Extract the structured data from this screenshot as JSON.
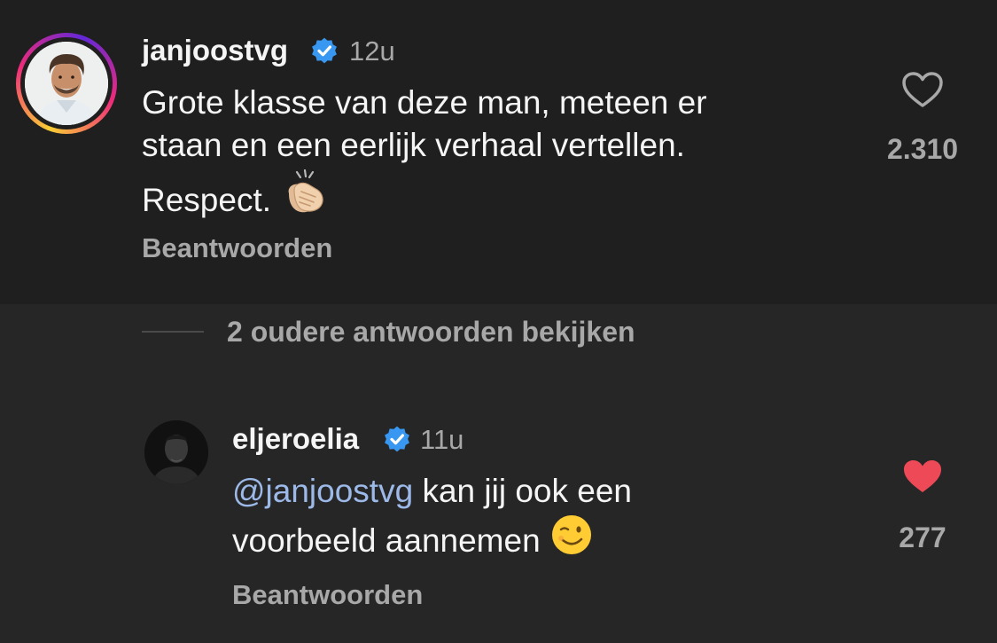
{
  "comment": {
    "username": "janjoostvg",
    "time": "12u",
    "text_line1": "Grote klasse van deze man, meteen er",
    "text_line2": "staan en een eerlijk verhaal vertellen.",
    "text_line3": "Respect.",
    "emoji": "clapping-hands-light-skin",
    "likes": "2.310",
    "liked": false,
    "reply_label": "Beantwoorden"
  },
  "view_replies_label": "2 oudere antwoorden bekijken",
  "reply": {
    "username": "eljeroelia",
    "time": "11u",
    "mention": "@janjoostvg",
    "text_line1_rest": "kan jij ook een",
    "text_line2": "voorbeeld aannemen",
    "emoji": "winking-face",
    "likes": "277",
    "liked": true,
    "reply_label": "Beantwoorden"
  },
  "colors": {
    "background": "#262626",
    "top_comment_background": "#1f1f1f",
    "verified_badge": "#3897f0",
    "liked_heart": "#ed4956",
    "mention": "#9cb9e8",
    "secondary_text": "#a8a8a8"
  }
}
